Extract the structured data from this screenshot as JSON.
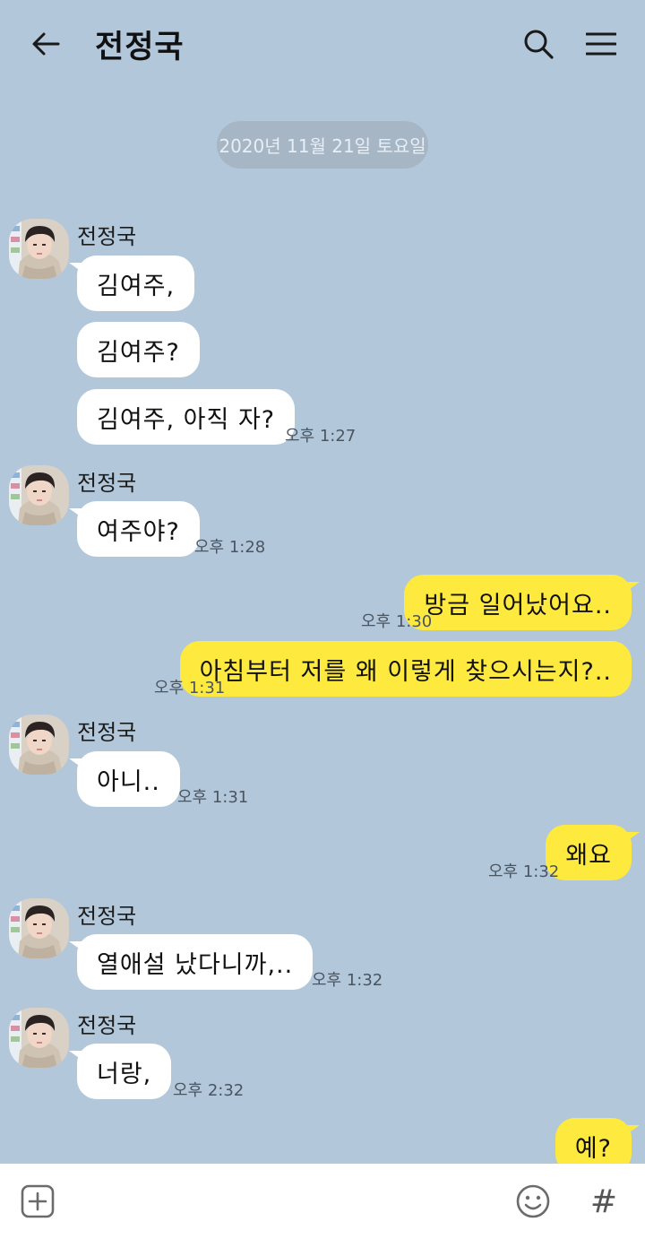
{
  "header": {
    "title": "전정국",
    "back_icon": "arrow-left-icon",
    "search_icon": "search-icon",
    "menu_icon": "hamburger-menu-icon"
  },
  "date_divider": "2020년 11월 21일 토요일",
  "contact_name": "전정국",
  "messages": [
    {
      "from": "in",
      "sender": "전정국",
      "text": "김여주,",
      "time": ""
    },
    {
      "from": "in",
      "text": "김여주?",
      "time": ""
    },
    {
      "from": "in",
      "text": "김여주, 아직 자?",
      "time": "오후 1:27"
    },
    {
      "from": "in",
      "sender": "전정국",
      "text": "여주야?",
      "time": "오후 1:28"
    },
    {
      "from": "out",
      "text": "방금 일어났어요..",
      "time": "오후 1:30"
    },
    {
      "from": "out",
      "text": "아침부터 저를 왜 이렇게 찾으시는지?..",
      "time": "오후 1:31"
    },
    {
      "from": "in",
      "sender": "전정국",
      "text": "아니..",
      "time": "오후 1:31"
    },
    {
      "from": "out",
      "text": "왜요",
      "time": "오후 1:32"
    },
    {
      "from": "in",
      "sender": "전정국",
      "text": "열애설 났다니까,..",
      "time": "오후 1:32"
    },
    {
      "from": "in",
      "sender": "전정국",
      "text": "너랑,",
      "time": "오후 2:32"
    },
    {
      "from": "out",
      "text": "예?",
      "time": ""
    }
  ],
  "composer": {
    "plus_icon": "plus-square-icon",
    "emoji_icon": "emoji-icon",
    "hash_label": "#"
  },
  "colors": {
    "background": "#b2c7da",
    "incoming_bubble": "#ffffff",
    "outgoing_bubble": "#fee93f",
    "date_badge": "#a6b6c5"
  }
}
